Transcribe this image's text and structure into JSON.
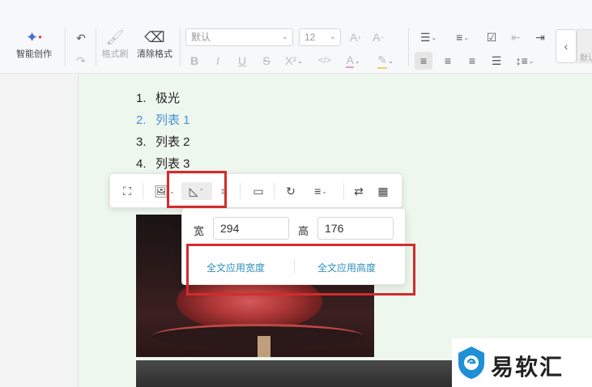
{
  "toolbar": {
    "ai_label": "智能创作",
    "format_painter_label": "格式刷",
    "clear_format_label": "清除格式",
    "font_family": "默认",
    "font_size": "12",
    "partial_style_label": "默认"
  },
  "document": {
    "list": [
      {
        "num": "1.",
        "text": "极光"
      },
      {
        "num": "2.",
        "text": "列表 1"
      },
      {
        "num": "3.",
        "text": "列表 2"
      },
      {
        "num": "4.",
        "text": "列表 3"
      }
    ]
  },
  "image_size_popover": {
    "width_label": "宽",
    "width_value": "294",
    "height_label": "高",
    "height_value": "176",
    "apply_width_label": "全文应用宽度",
    "apply_height_label": "全文应用高度"
  },
  "watermark": {
    "text": "易软汇"
  },
  "colors": {
    "accent": "#2e8fb8",
    "highlight_red": "#d22c2c",
    "doc_bg": "#eef7ee",
    "active_list_item": "#4a8fd8"
  }
}
